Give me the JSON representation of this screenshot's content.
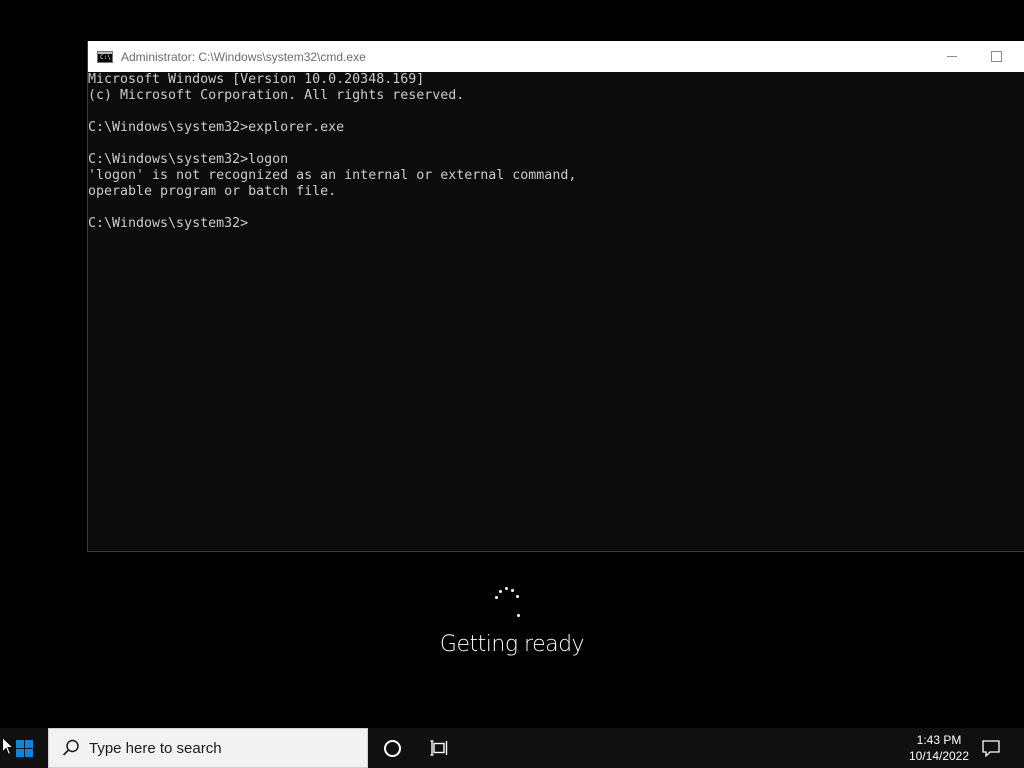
{
  "window": {
    "title": "Administrator: C:\\Windows\\system32\\cmd.exe",
    "icon_text": "C:\\"
  },
  "console": {
    "lines": [
      "Microsoft Windows [Version 10.0.20348.169]",
      "(c) Microsoft Corporation. All rights reserved.",
      "",
      "C:\\Windows\\system32>explorer.exe",
      "",
      "C:\\Windows\\system32>logon",
      "'logon' is not recognized as an internal or external command,",
      "operable program or batch file.",
      "",
      "C:\\Windows\\system32>"
    ]
  },
  "status": {
    "message": "Getting ready"
  },
  "taskbar": {
    "search_placeholder": "Type here to search",
    "time": "1:43 PM",
    "date": "10/14/2022"
  },
  "colors": {
    "console_bg": "#0c0c0c",
    "console_text": "#cccccc",
    "windows_accent": "#0a86d9",
    "taskbar_bg": "#101010"
  },
  "icons": {
    "start": "windows-logo-icon",
    "search": "magnifier-icon",
    "cortana": "cortana-circle-icon",
    "task_view": "task-view-icon",
    "notifications": "action-center-icon",
    "cmd": "cmd-console-icon",
    "spinner": "loading-dots-icon"
  }
}
